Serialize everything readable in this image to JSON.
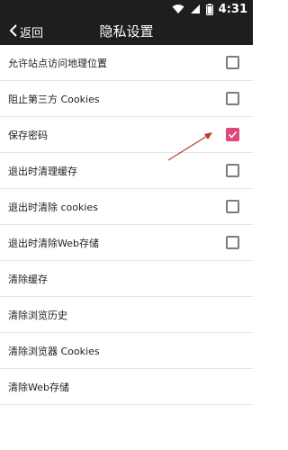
{
  "status_bar": {
    "time": "4:31"
  },
  "header": {
    "back_label": "返回",
    "title": "隐私设置"
  },
  "settings": [
    {
      "label": "允许站点访问地理位置",
      "has_checkbox": true,
      "checked": false
    },
    {
      "label": "阻止第三方 Cookies",
      "has_checkbox": true,
      "checked": false
    },
    {
      "label": "保存密码",
      "has_checkbox": true,
      "checked": true
    },
    {
      "label": "退出时清理缓存",
      "has_checkbox": true,
      "checked": false
    },
    {
      "label": "退出时清除 cookies",
      "has_checkbox": true,
      "checked": false
    },
    {
      "label": "退出时清除Web存储",
      "has_checkbox": true,
      "checked": false
    },
    {
      "label": "清除缓存",
      "has_checkbox": false
    },
    {
      "label": "清除浏览历史",
      "has_checkbox": false
    },
    {
      "label": "清除浏览器 Cookies",
      "has_checkbox": false
    },
    {
      "label": "清除Web存储",
      "has_checkbox": false
    }
  ],
  "colors": {
    "bar_background": "#1e1e1e",
    "checkbox_checked": "#e0457b",
    "checkbox_unchecked": "#7d7d7d",
    "annotation_arrow": "#c0392b"
  }
}
